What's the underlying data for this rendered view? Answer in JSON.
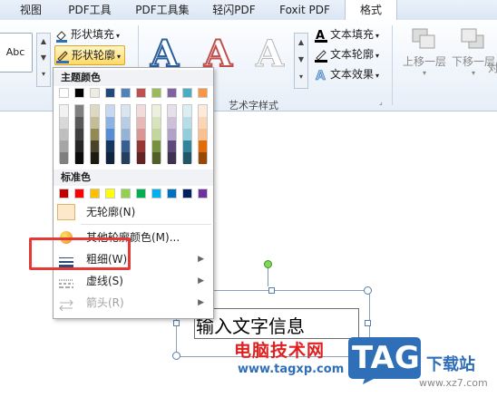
{
  "tabs": [
    "视图",
    "PDF工具",
    "PDF工具集",
    "轻闪PDF",
    "Foxit PDF",
    "格式"
  ],
  "active_tab": "格式",
  "ribbon": {
    "shape_style_sample": "Abc",
    "shape_fill": "形状填充",
    "shape_outline": "形状轮廓",
    "wordart_group": "艺术字样式",
    "text_fill": "文本填充",
    "text_outline": "文本轮廓",
    "text_effect": "文本效果",
    "bring_forward": "上移一层",
    "send_backward": "下移一层",
    "align": "对"
  },
  "dropdown": {
    "theme_colors_label": "主题颜色",
    "theme_top": [
      "#ffffff",
      "#000000",
      "#eeece1",
      "#1f497d",
      "#4f81bd",
      "#c0504d",
      "#9bbb59",
      "#8064a2",
      "#4bacc6",
      "#f79646"
    ],
    "theme_shades": [
      [
        "#f2f2f2",
        "#7f7f7f",
        "#ddd9c3",
        "#c6d9f0",
        "#dbe5f1",
        "#f2dcdb",
        "#ebf1dd",
        "#e5e0ec",
        "#dbeef3",
        "#fdeada"
      ],
      [
        "#d8d8d8",
        "#595959",
        "#c4bd97",
        "#8db3e2",
        "#b8cce4",
        "#e5b9b7",
        "#d7e3bc",
        "#ccc1d9",
        "#b7dde8",
        "#fbd5b5"
      ],
      [
        "#bfbfbf",
        "#3f3f3f",
        "#938953",
        "#548dd4",
        "#95b3d7",
        "#d99694",
        "#c3d69b",
        "#b2a2c7",
        "#92cddc",
        "#fac08f"
      ],
      [
        "#a5a5a5",
        "#262626",
        "#494429",
        "#17365d",
        "#366092",
        "#953734",
        "#76923c",
        "#5f497a",
        "#31859b",
        "#e36c09"
      ],
      [
        "#7f7f7f",
        "#0c0c0c",
        "#1d1b10",
        "#0f243e",
        "#244061",
        "#632423",
        "#4f6128",
        "#3f3151",
        "#205867",
        "#974806"
      ]
    ],
    "standard_colors_label": "标准色",
    "standard": [
      "#c00000",
      "#ff0000",
      "#ffc000",
      "#ffff00",
      "#92d050",
      "#00b050",
      "#00b0f0",
      "#0070c0",
      "#002060",
      "#7030a0"
    ],
    "no_outline": "无轮廓(N)",
    "more_colors": "其他轮廓颜色(M)...",
    "weight": "粗细(W)",
    "dashes": "虚线(S)",
    "arrows": "箭头(R)"
  },
  "slide": {
    "textbox_text": "输入文字信息"
  },
  "watermark": {
    "site_name": "电脑技术网",
    "url": "www.tagxp.com",
    "logo": "TAG",
    "right_text": "下载站",
    "right_url": "www.xz7.com"
  },
  "colors": {
    "highlight_box": "#e53935",
    "accent_blue": "#2e6fb7"
  }
}
